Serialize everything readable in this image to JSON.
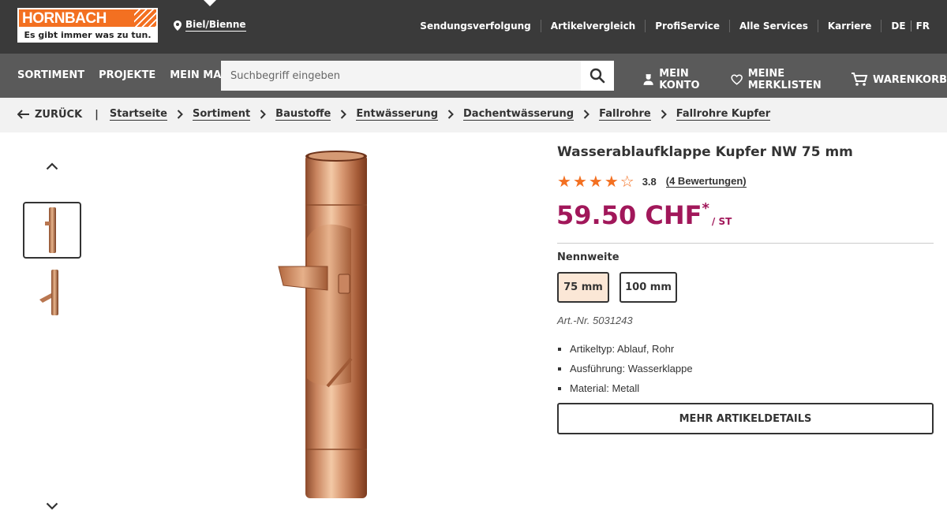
{
  "header": {
    "logo_name": "HORNBACH",
    "logo_slogan": "Es gibt immer was zu tun.",
    "location": "Biel/Bienne",
    "top_links": [
      "Sendungsverfolgung",
      "Artikelvergleich",
      "ProfiService",
      "Alle Services",
      "Karriere"
    ],
    "languages": [
      "DE",
      "FR"
    ]
  },
  "mainnav": {
    "items": [
      "SORTIMENT",
      "PROJEKTE",
      "MEIN MARKT"
    ],
    "search_placeholder": "Suchbegriff eingeben",
    "account": "MEIN KONTO",
    "wishlist": "MEINE MERKLISTEN",
    "cart": "WARENKORB"
  },
  "breadcrumb": {
    "back": "ZURÜCK",
    "items": [
      "Startseite",
      "Sortiment",
      "Baustoffe",
      "Entwässerung",
      "Dachentwässerung",
      "Fallrohre",
      "Fallrohre Kupfer"
    ]
  },
  "product": {
    "title": "Wasserablaufklappe Kupfer NW 75 mm",
    "rating": 3.8,
    "rating_text": "3.8",
    "stars_filled": 4,
    "stars_total": 5,
    "review_count": "(4 Bewertungen)",
    "price": "59.50 CHF",
    "price_mark": "*",
    "price_unit": "/ ST",
    "variant_label": "Nennweite",
    "variants": [
      "75 mm",
      "100 mm"
    ],
    "selected_variant": "75 mm",
    "article_number": "Art.-Nr. 5031243",
    "features": [
      "Artikeltyp: Ablauf, Rohr",
      "Ausführung: Wasserklappe",
      "Material: Metall"
    ],
    "details_button": "MEHR ARTIKELDETAILS"
  },
  "colors": {
    "brand_orange": "#f37021",
    "price": "#a1175a",
    "topbar": "#3a3a3a",
    "navbar": "#5a5a5a"
  }
}
